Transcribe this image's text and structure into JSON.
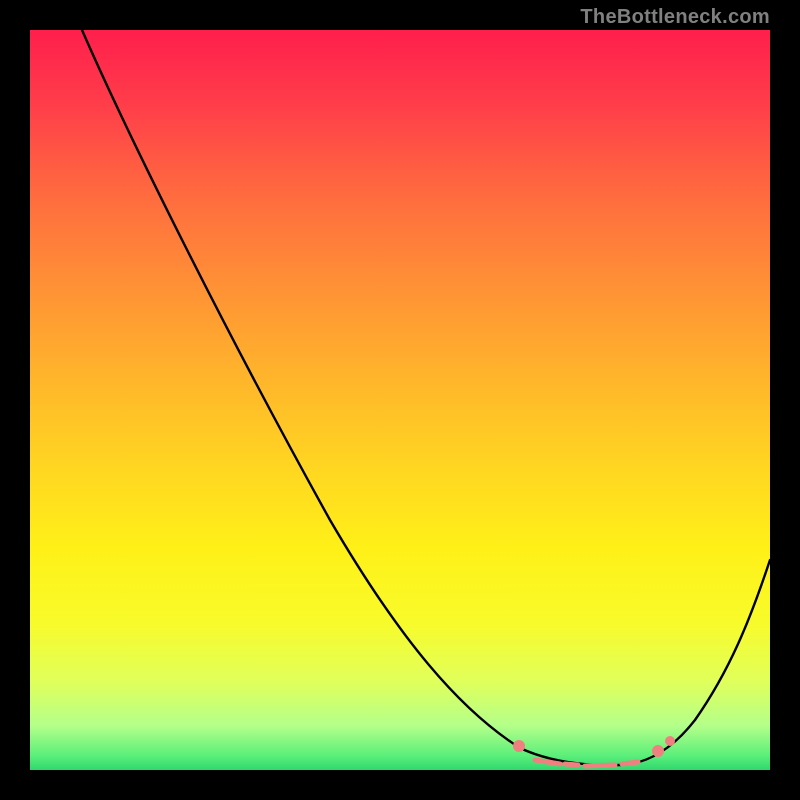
{
  "attribution": "TheBottleneck.com",
  "chart_data": {
    "type": "line",
    "title": "",
    "xlabel": "",
    "ylabel": "",
    "xlim": [
      0,
      100
    ],
    "ylim": [
      0,
      100
    ],
    "series": [
      {
        "name": "bottleneck-curve",
        "x": [
          7,
          20,
          35,
          50,
          62,
          69,
          73,
          78,
          82,
          88,
          100
        ],
        "y": [
          100,
          78,
          52,
          28,
          12,
          4,
          1,
          0.3,
          1.5,
          7,
          30
        ]
      }
    ],
    "markers": {
      "name": "highlight-strip",
      "x_range": [
        66,
        86
      ],
      "y": 2
    },
    "background_gradient": [
      "#ff1f4c",
      "#ff6a3f",
      "#ffb22c",
      "#fff018",
      "#b4ff8a",
      "#2fd86f"
    ]
  }
}
